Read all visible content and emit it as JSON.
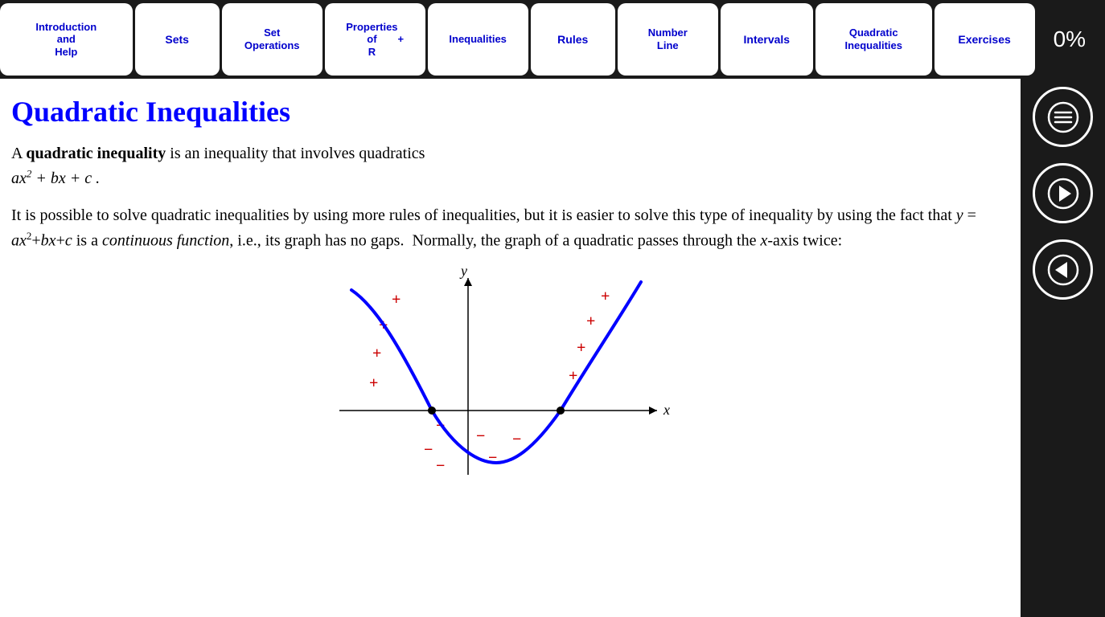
{
  "nav": {
    "items": [
      {
        "id": "intro",
        "label": "Introduction\nand\nHelp",
        "class": "nav-item-intro",
        "active": false
      },
      {
        "id": "sets",
        "label": "Sets",
        "class": "nav-item-sets",
        "active": false
      },
      {
        "id": "setops",
        "label": "Set\nOperations",
        "class": "nav-item-setops",
        "active": false
      },
      {
        "id": "props",
        "label": "Properties\nof\nR⁺",
        "class": "nav-item-props",
        "active": false
      },
      {
        "id": "ineq",
        "label": "Inequalities",
        "class": "nav-item-ineq",
        "active": false
      },
      {
        "id": "rules",
        "label": "Rules",
        "class": "nav-item-rules",
        "active": false
      },
      {
        "id": "numline",
        "label": "Number\nLine",
        "class": "nav-item-numline",
        "active": false
      },
      {
        "id": "intervals",
        "label": "Intervals",
        "class": "nav-item-intervals",
        "active": false
      },
      {
        "id": "quadineq",
        "label": "Quadratic\nInequalities",
        "class": "nav-item-quadineq",
        "active": true
      },
      {
        "id": "exercises",
        "label": "Exercises",
        "class": "nav-item-exercises",
        "active": false
      }
    ],
    "progress": "0%"
  },
  "page": {
    "title": "Quadratic Inequalities",
    "intro_p1_a": "A ",
    "intro_bold": "quadratic inequality",
    "intro_p1_b": " is an inequality that involves quadratics",
    "intro_formula": "ax² + bx + c.",
    "body_p1": "It is possible to solve quadratic inequalities by using more rules of inequalities, but it is easier to solve this type of inequality by using the fact that ",
    "body_formula1": "y = ax²+bx+c",
    "body_p1_b": " is a ",
    "body_italic": "continuous function",
    "body_p1_c": ", i.e., its graph has no gaps.  Normally, the graph of a quadratic passes through the ",
    "body_xaxis": "x",
    "body_p1_d": "-axis twice:"
  },
  "sidebar": {
    "menu_icon": "≡",
    "next_icon": "→",
    "prev_icon": "←"
  }
}
